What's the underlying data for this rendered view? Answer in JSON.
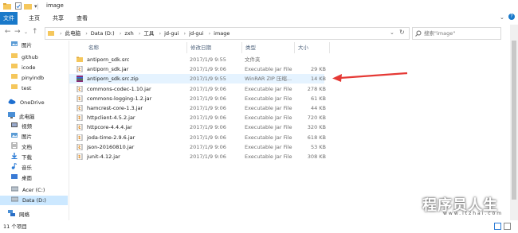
{
  "window": {
    "title": "image"
  },
  "ribbon": {
    "tabs": [
      "文件",
      "主页",
      "共享",
      "查看"
    ]
  },
  "address": {
    "crumbs": [
      "此电脑",
      "Data (D:)",
      "zxh",
      "工具",
      "jd-gui",
      "jd-gui",
      "image"
    ]
  },
  "search": {
    "placeholder": "搜索\"image\""
  },
  "nav": {
    "items": [
      {
        "label": "图片",
        "icon": "pictures-icon"
      },
      {
        "label": "github",
        "icon": "folder-icon"
      },
      {
        "label": "icode",
        "icon": "folder-icon"
      },
      {
        "label": "pinyindb",
        "icon": "folder-icon"
      },
      {
        "label": "test",
        "icon": "folder-icon"
      },
      {
        "label": "OneDrive",
        "icon": "cloud-icon"
      },
      {
        "label": "此电脑",
        "icon": "computer-icon"
      },
      {
        "label": "视频",
        "icon": "video-icon"
      },
      {
        "label": "图片",
        "icon": "pictures-icon"
      },
      {
        "label": "文档",
        "icon": "document-icon"
      },
      {
        "label": "下载",
        "icon": "download-icon"
      },
      {
        "label": "音乐",
        "icon": "music-icon"
      },
      {
        "label": "桌面",
        "icon": "desktop-icon"
      },
      {
        "label": "Acer (C:)",
        "icon": "drive-icon"
      },
      {
        "label": "Data (D:)",
        "icon": "drive-icon"
      },
      {
        "label": "网络",
        "icon": "network-icon"
      }
    ]
  },
  "columns": {
    "name": "名称",
    "date": "修改日期",
    "type": "类型",
    "size": "大小"
  },
  "files": [
    {
      "name": "antiporn_sdk.src",
      "date": "2017/1/9 9:55",
      "type": "文件夹",
      "size": "",
      "icon": "folder-icon"
    },
    {
      "name": "antiporn_sdk.jar",
      "date": "2017/1/9 9:06",
      "type": "Executable Jar File",
      "size": "29 KB",
      "icon": "jar-icon"
    },
    {
      "name": "antiporn_sdk.src.zip",
      "date": "2017/1/9 9:55",
      "type": "WinRAR ZIP 压缩...",
      "size": "14 KB",
      "icon": "zip-icon"
    },
    {
      "name": "commons-codec-1.10.jar",
      "date": "2017/1/9 9:06",
      "type": "Executable Jar File",
      "size": "278 KB",
      "icon": "jar-icon"
    },
    {
      "name": "commons-logging-1.2.jar",
      "date": "2017/1/9 9:06",
      "type": "Executable Jar File",
      "size": "61 KB",
      "icon": "jar-icon"
    },
    {
      "name": "hamcrest-core-1.3.jar",
      "date": "2017/1/9 9:06",
      "type": "Executable Jar File",
      "size": "44 KB",
      "icon": "jar-icon"
    },
    {
      "name": "httpclient-4.5.2.jar",
      "date": "2017/1/9 9:06",
      "type": "Executable Jar File",
      "size": "720 KB",
      "icon": "jar-icon"
    },
    {
      "name": "httpcore-4.4.4.jar",
      "date": "2017/1/9 9:06",
      "type": "Executable Jar File",
      "size": "320 KB",
      "icon": "jar-icon"
    },
    {
      "name": "joda-time-2.9.6.jar",
      "date": "2017/1/9 9:06",
      "type": "Executable Jar File",
      "size": "618 KB",
      "icon": "jar-icon"
    },
    {
      "name": "json-20160810.jar",
      "date": "2017/1/9 9:06",
      "type": "Executable Jar File",
      "size": "53 KB",
      "icon": "jar-icon"
    },
    {
      "name": "junit-4.12.jar",
      "date": "2017/1/9 9:06",
      "type": "Executable Jar File",
      "size": "308 KB",
      "icon": "jar-icon"
    }
  ],
  "status": {
    "text": "11 个项目"
  },
  "watermark": {
    "text": "程序员人生",
    "sub": "www.itzhai.com"
  },
  "colors": {
    "accent": "#1979ca",
    "selection": "#e5f3ff",
    "arrow": "#e53935"
  }
}
